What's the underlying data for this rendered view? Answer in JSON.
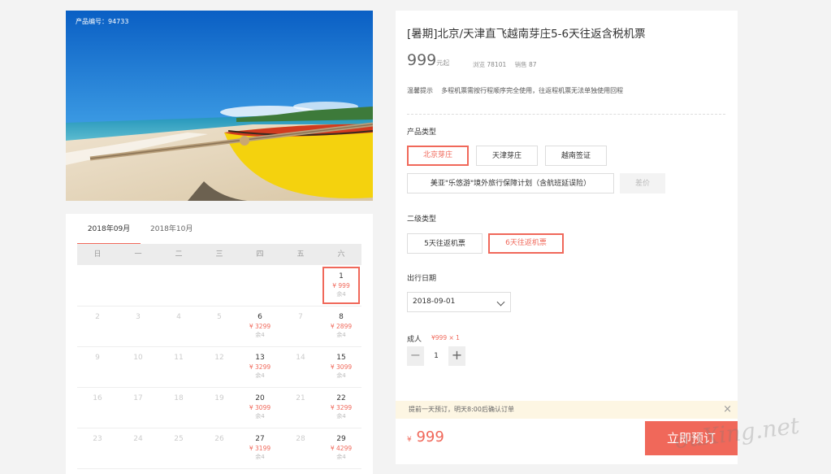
{
  "hero": {
    "product_id": "产品编号：94733"
  },
  "calendar": {
    "tabs": [
      "2018年09月",
      "2018年10月"
    ],
    "weekdays": [
      "日",
      "一",
      "二",
      "三",
      "四",
      "五",
      "六"
    ],
    "days": [
      {
        "d": "1",
        "p": "¥ 999",
        "s": "余4"
      },
      {
        "d": "2"
      },
      {
        "d": "3"
      },
      {
        "d": "4"
      },
      {
        "d": "5"
      },
      {
        "d": "6",
        "p": "¥ 3299",
        "s": "余4"
      },
      {
        "d": "7"
      },
      {
        "d": "8",
        "p": "¥ 2899",
        "s": "余4"
      },
      {
        "d": "9"
      },
      {
        "d": "10"
      },
      {
        "d": "11"
      },
      {
        "d": "12"
      },
      {
        "d": "13",
        "p": "¥ 3299",
        "s": "余4"
      },
      {
        "d": "14"
      },
      {
        "d": "15",
        "p": "¥ 3099",
        "s": "余4"
      },
      {
        "d": "16"
      },
      {
        "d": "17"
      },
      {
        "d": "18"
      },
      {
        "d": "19"
      },
      {
        "d": "20",
        "p": "¥ 3099",
        "s": "余4"
      },
      {
        "d": "21"
      },
      {
        "d": "22",
        "p": "¥ 3299",
        "s": "余4"
      },
      {
        "d": "23"
      },
      {
        "d": "24"
      },
      {
        "d": "25"
      },
      {
        "d": "26"
      },
      {
        "d": "27",
        "p": "¥ 3199",
        "s": "余4"
      },
      {
        "d": "28"
      },
      {
        "d": "29",
        "p": "¥ 4299",
        "s": "余4"
      }
    ]
  },
  "product": {
    "title": "[暑期]北京/天津直飞越南芽庄5-6天往返含税机票",
    "price": "999",
    "price_unit": "元起",
    "views_label": "浏览",
    "views": "78101",
    "sales_label": "销售",
    "sales": "87",
    "tip_label": "温馨提示",
    "tip_text": "多程机票需按行程顺序完全使用，往返程机票无法单独使用回程",
    "type_label": "产品类型",
    "types": [
      "北京芽庄",
      "天津芽庄",
      "越南签证"
    ],
    "insurance": "美亚\"乐悠游\"境外旅行保障计划（含航班延误险）",
    "price_diff": "差价",
    "sub_type_label": "二级类型",
    "sub_types": [
      "5天往返机票",
      "6天往返机票"
    ],
    "date_label": "出行日期",
    "date_value": "2018-09-01",
    "adult_label": "成人",
    "adult_price": "¥999 × 1",
    "quantity": "1"
  },
  "notice": {
    "text": "提前一天预订，明天8:00后确认订单",
    "close": "×"
  },
  "footer": {
    "currency": "¥",
    "total": "999",
    "book_label": "立即预订"
  },
  "watermark": "ouXing.net"
}
